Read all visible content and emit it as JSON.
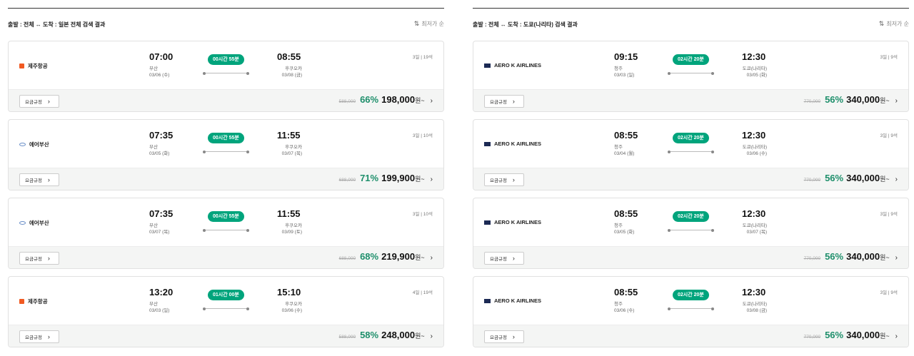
{
  "panels": [
    {
      "title": "출발 : 전체 ↔ 도착 : 일본 전체 검색 결과",
      "sort_label": "최저가 순",
      "cards": [
        {
          "airline": "제주항공",
          "logo": "jeju-air-logo",
          "dep_time": "07:00",
          "dep_city": "부산",
          "dep_date": "03/06 (수)",
          "duration": "00시간 55분",
          "arr_time": "08:55",
          "arr_city": "후쿠오카",
          "arr_date": "03/08 (금)",
          "seats": "3일 | 19석",
          "fare_label": "요금규정",
          "orig_price": "588,000",
          "discount": "66%",
          "price": "198,000",
          "unit": "원~"
        },
        {
          "airline": "에어부산",
          "logo": "air-busan-logo",
          "dep_time": "07:35",
          "dep_city": "부산",
          "dep_date": "03/05 (화)",
          "duration": "00시간 55분",
          "arr_time": "11:55",
          "arr_city": "후쿠오카",
          "arr_date": "03/07 (목)",
          "seats": "3일 | 10석",
          "fare_label": "요금규정",
          "orig_price": "688,000",
          "discount": "71%",
          "price": "199,900",
          "unit": "원~"
        },
        {
          "airline": "에어부산",
          "logo": "air-busan-logo",
          "dep_time": "07:35",
          "dep_city": "부산",
          "dep_date": "03/07 (목)",
          "duration": "00시간 55분",
          "arr_time": "11:55",
          "arr_city": "후쿠오카",
          "arr_date": "03/09 (토)",
          "seats": "3일 | 10석",
          "fare_label": "요금규정",
          "orig_price": "688,000",
          "discount": "68%",
          "price": "219,900",
          "unit": "원~"
        },
        {
          "airline": "제주항공",
          "logo": "jeju-air-logo",
          "dep_time": "13:20",
          "dep_city": "부산",
          "dep_date": "03/03 (일)",
          "duration": "01시간 00분",
          "arr_time": "15:10",
          "arr_city": "후쿠오카",
          "arr_date": "03/06 (수)",
          "seats": "4일 | 19석",
          "fare_label": "요금규정",
          "orig_price": "588,000",
          "discount": "58%",
          "price": "248,000",
          "unit": "원~"
        }
      ]
    },
    {
      "title": "출발 : 전체 ↔ 도착 : 도쿄(나리타) 검색 결과",
      "sort_label": "최저가 순",
      "cards": [
        {
          "airline": "AERO K AIRLINES",
          "logo": "aero-k-logo",
          "dep_time": "09:15",
          "dep_city": "청주",
          "dep_date": "03/03 (일)",
          "duration": "02시간 20분",
          "arr_time": "12:30",
          "arr_city": "도쿄(나리타)",
          "arr_date": "03/05 (화)",
          "seats": "3일 | 9석",
          "fare_label": "요금규정",
          "orig_price": "770,000",
          "discount": "56%",
          "price": "340,000",
          "unit": "원~"
        },
        {
          "airline": "AERO K AIRLINES",
          "logo": "aero-k-logo",
          "dep_time": "08:55",
          "dep_city": "청주",
          "dep_date": "03/04 (월)",
          "duration": "02시간 20분",
          "arr_time": "12:30",
          "arr_city": "도쿄(나리타)",
          "arr_date": "03/06 (수)",
          "seats": "3일 | 9석",
          "fare_label": "요금규정",
          "orig_price": "770,000",
          "discount": "56%",
          "price": "340,000",
          "unit": "원~"
        },
        {
          "airline": "AERO K AIRLINES",
          "logo": "aero-k-logo",
          "dep_time": "08:55",
          "dep_city": "청주",
          "dep_date": "03/05 (화)",
          "duration": "02시간 20분",
          "arr_time": "12:30",
          "arr_city": "도쿄(나리타)",
          "arr_date": "03/07 (목)",
          "seats": "3일 | 9석",
          "fare_label": "요금규정",
          "orig_price": "770,000",
          "discount": "56%",
          "price": "340,000",
          "unit": "원~"
        },
        {
          "airline": "AERO K AIRLINES",
          "logo": "aero-k-logo",
          "dep_time": "08:55",
          "dep_city": "청주",
          "dep_date": "03/06 (수)",
          "duration": "02시간 20분",
          "arr_time": "12:30",
          "arr_city": "도쿄(나리타)",
          "arr_date": "03/08 (금)",
          "seats": "3일 | 9석",
          "fare_label": "요금규정",
          "orig_price": "770,000",
          "discount": "56%",
          "price": "340,000",
          "unit": "원~"
        }
      ]
    }
  ],
  "colors": {
    "accent": "#00a47c",
    "discount": "#1e8f6b"
  }
}
